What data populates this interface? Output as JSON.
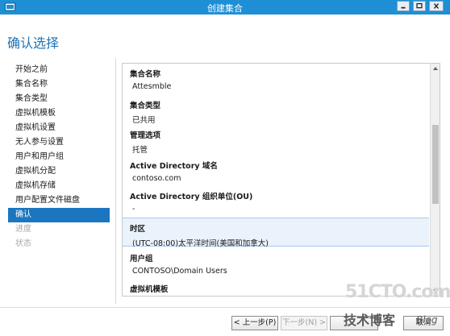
{
  "window": {
    "title": "创建集合",
    "controls": {
      "minimize": "minimize",
      "maximize": "maximize",
      "close": "close"
    }
  },
  "page": {
    "heading": "确认选择"
  },
  "nav": {
    "items": [
      {
        "label": "开始之前",
        "state": "normal"
      },
      {
        "label": "集合名称",
        "state": "normal"
      },
      {
        "label": "集合类型",
        "state": "normal"
      },
      {
        "label": "虚拟机模板",
        "state": "normal"
      },
      {
        "label": "虚拟机设置",
        "state": "normal"
      },
      {
        "label": "无人参与设置",
        "state": "normal"
      },
      {
        "label": "用户和用户组",
        "state": "normal"
      },
      {
        "label": "虚拟机分配",
        "state": "normal"
      },
      {
        "label": "虚拟机存储",
        "state": "normal"
      },
      {
        "label": "用户配置文件磁盘",
        "state": "normal"
      },
      {
        "label": "确认",
        "state": "active"
      },
      {
        "label": "进度",
        "state": "disabled"
      },
      {
        "label": "状态",
        "state": "disabled"
      }
    ]
  },
  "confirmation": {
    "sections": [
      {
        "label": "集合名称",
        "value": "Attesmble"
      },
      {
        "label": "集合类型",
        "value": "已共用"
      },
      {
        "label": "管理选项",
        "value": "托管"
      },
      {
        "label": "Active Directory 域名",
        "value": "contoso.com"
      },
      {
        "label": "Active Directory 组织单位(OU)",
        "value": "-"
      },
      {
        "label": "时区",
        "value": "(UTC-08:00)太平洋时间(美国和加拿大)"
      },
      {
        "label": "用户组",
        "value": "CONTOSO\\Domain Users"
      },
      {
        "label": "虚拟机模板",
        "value": ""
      }
    ]
  },
  "buttons": {
    "prev": "< 上一步(P)",
    "next": "下一步(N) >",
    "create": "",
    "cancel": "取消"
  },
  "watermark": {
    "line1": "51CTO.com",
    "line2": "技术博客",
    "line3": "Blog"
  },
  "colors": {
    "titlebar": "#1e8fd4",
    "accent": "#1c76bf",
    "heading": "#1e73b4",
    "highlight": "#eaf2fc"
  }
}
